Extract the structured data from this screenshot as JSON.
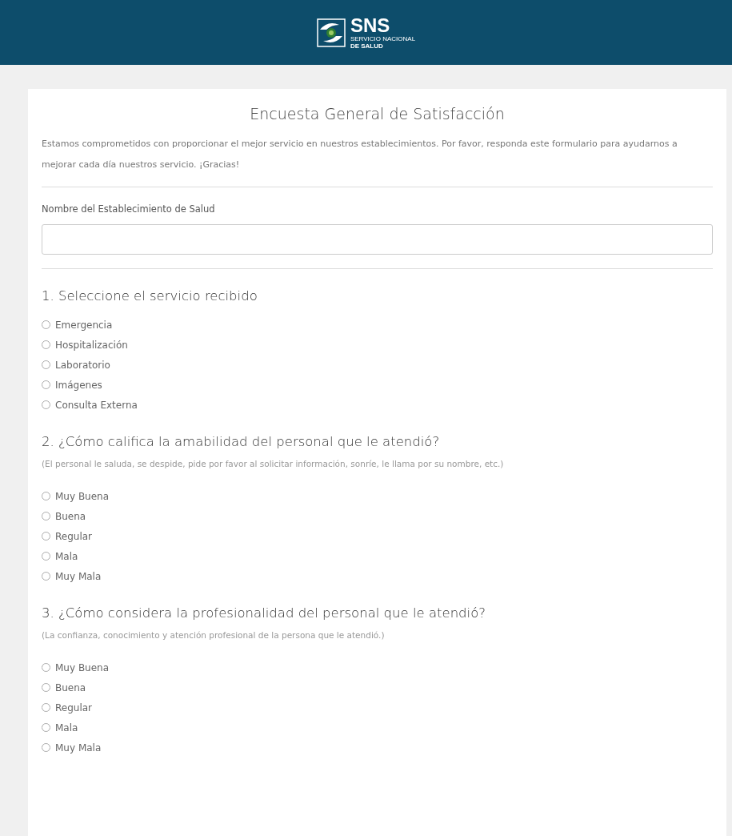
{
  "header": {
    "logo": {
      "acronym": "SNS",
      "line_1": "SERVICIO NACIONAL",
      "line_2": "DE SALUD"
    }
  },
  "form": {
    "title": "Encuesta General de Satisfacción",
    "description": "Estamos comprometidos con proporcionar el mejor servicio en nuestros establecimientos. Por favor, responda este formulario para ayudarnos a mejorar cada día nuestros servicio. ¡Gracias!",
    "field": {
      "label": "Nombre del Establecimiento de Salud"
    },
    "questions": [
      {
        "title": "1. Seleccione el servicio recibido",
        "options": [
          {
            "label": "Emergencia",
            "selected": false
          },
          {
            "label": "Hospitalización",
            "selected": false
          },
          {
            "label": "Laboratorio",
            "selected": false
          },
          {
            "label": "Imágenes",
            "selected": false
          },
          {
            "label": "Consulta Externa",
            "selected": false
          }
        ]
      },
      {
        "title": "2. ¿Cómo califica la amabilidad del personal que le atendió?",
        "note": "(El personal le saluda, se despide, pide por favor al solicitar información, sonríe, le llama por su nombre, etc.)",
        "options": [
          {
            "label": "Muy Buena",
            "selected": false
          },
          {
            "label": "Buena",
            "selected": false
          },
          {
            "label": "Regular",
            "selected": false
          },
          {
            "label": "Mala",
            "selected": false
          },
          {
            "label": "Muy Mala",
            "selected": false
          }
        ]
      },
      {
        "title": "3. ¿Cómo considera la profesionalidad del personal que le atendió?",
        "note": "(La confianza, conocimiento y atención profesional de la persona que le atendió.)",
        "options": [
          {
            "label": "Muy Buena",
            "selected": false
          },
          {
            "label": "Buena",
            "selected": false
          },
          {
            "label": "Regular",
            "selected": false
          },
          {
            "label": "Mala",
            "selected": false
          },
          {
            "label": "Muy Mala",
            "selected": false
          }
        ]
      }
    ]
  }
}
